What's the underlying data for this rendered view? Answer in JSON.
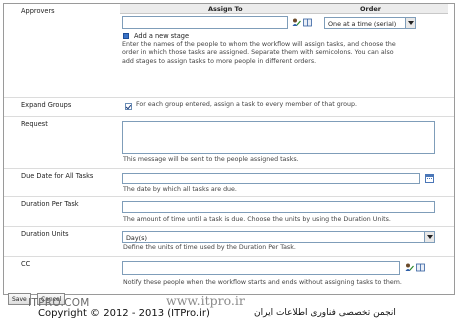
{
  "approvers": {
    "label": "Approvers",
    "col_assign_to": "Assign To",
    "col_order": "Order",
    "order_value": "One at a time (serial)",
    "add_stage_label": "Add a new stage",
    "help": [
      "Enter the names of the people to whom the workflow will assign tasks, and choose the",
      "order in which those tasks are assigned. Separate them with semicolons. You can also",
      "add stages to assign tasks to more people in different orders."
    ]
  },
  "expand_groups": {
    "label": "Expand Groups",
    "checked": true,
    "text": "For each group entered, assign a task to every member of that group."
  },
  "request": {
    "label": "Request",
    "help": "This message will be sent to the people assigned tasks."
  },
  "due_date": {
    "label": "Due Date for All Tasks",
    "help": "The date by which all tasks are due."
  },
  "duration_per_task": {
    "label": "Duration Per Task",
    "help": "The amount of time until a task is due. Choose the units by using the Duration Units."
  },
  "duration_units": {
    "label": "Duration Units",
    "value": "Day(s)",
    "help": "Define the units of time used by the Duration Per Task."
  },
  "cc": {
    "label": "CC",
    "help": "Notify these people when the workflow starts and ends without assigning tasks to them."
  },
  "footer": {
    "button_1": "Save",
    "button_2": "Cancel",
    "watermark_1": "ITPRO.COM",
    "watermark_2": "www.itpro.ir",
    "copyright": "Copyright © 2012 - 2013 (ITPro.ir)",
    "arabic": "انجمن تخصصی فناوری اطلاعات ایران"
  },
  "colors": {
    "border": "#7f9db9",
    "header_bg": "#ececec",
    "accent": "#3b73c7"
  }
}
